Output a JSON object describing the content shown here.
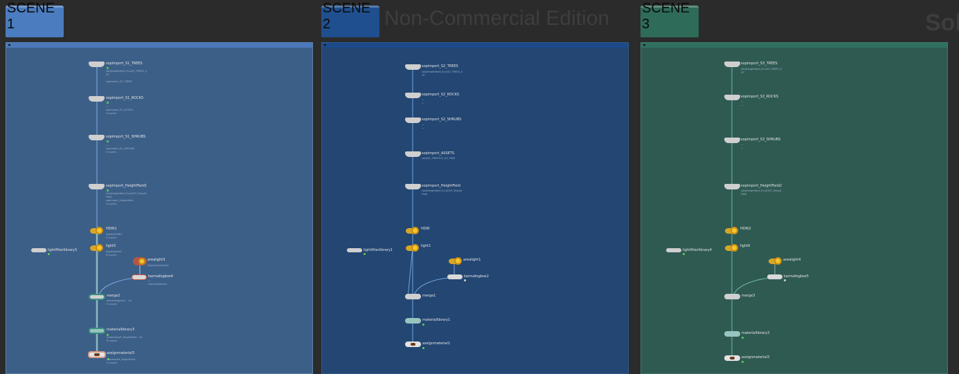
{
  "watermark": "Non-Commercial Edition",
  "watermark_right": "Sol",
  "tabs": [
    {
      "label": "SCENE 1",
      "color": "#4a7cbf"
    },
    {
      "label": "SCENE 2",
      "color": "#1f4f8f"
    },
    {
      "label": "SCENE 3",
      "color": "#2e6b58"
    }
  ],
  "panels": [
    {
      "bg": "#3c5f88",
      "bar": "#4a78b8"
    },
    {
      "bg": "#234672",
      "bar": "#1d4a88"
    },
    {
      "bg": "#2f5a52",
      "bar": "#2f7060"
    }
  ],
  "scene1": {
    "n1": {
      "label": "sopimport_S1_TREES",
      "info": "/obj/Heightfield_Ecu/S1_TREES_S\nHT\n\nsopimport_S1_TREES"
    },
    "n2": {
      "label": "sopimport_S1_ROCKS",
      "info": "—\nsopimport_S1_ROCKS\n3 Layers"
    },
    "n3": {
      "label": "sopimport_S1_SHRUBS",
      "info": "—\nsopimport_S1_SHRUBS\n3 Layers"
    },
    "n4": {
      "label": "sopimport_HeightField1",
      "info": "/obj/Heightfield_Ecu/OUT_Height\nField\nsopimport_Heightfield\n4 Layers"
    },
    "n5": {
      "label": "HDRI1",
      "info": "/lights/HDRI1\n5 Layers"
    },
    "n6": {
      "label": "light5",
      "info": "/lights/light5\n6 Layers"
    },
    "n7": {
      "label": "lightfilterlibrary3",
      "info": ""
    },
    "n8": {
      "label": "arealight3",
      "info": "/lights/arealight3"
    },
    "n9": {
      "label": "karmafogbox4",
      "info": "—\n/karmafogbox4"
    },
    "n10": {
      "label": "merge2",
      "info": "/karmafogbox4 ...16\n9 Layers"
    },
    "n11": {
      "label": "materiallibrary3",
      "info": "/materials/R_Heightfield...16\n8 Layers"
    },
    "n12": {
      "label": "assignmaterial3",
      "info": "/sopimport_HeightField\n9 Layers"
    }
  },
  "scene2": {
    "n1": {
      "label": "sopimport_S2_TREES",
      "info": "/obj/Heightfield_Ecu/S2_TREES_S\nHT"
    },
    "n2": {
      "label": "sopimport_S2_ROCKS",
      "info": "—\n—"
    },
    "n3": {
      "label": "sopimport_S2_SHRUBS",
      "info": "—\n—"
    },
    "n4": {
      "label": "sopimport_ASSETS",
      "info": "/obj/S3_TREEOUT_S3_TREE"
    },
    "n5": {
      "label": "sopimport_HeightField",
      "info": "/obj/Heightfield_Ecu/OUT_Height\nField"
    },
    "n6": {
      "label": "HDRI",
      "info": ""
    },
    "n7": {
      "label": "light1",
      "info": ""
    },
    "n8": {
      "label": "lightfilterlibrary1",
      "info": ""
    },
    "n9": {
      "label": "arealight1",
      "info": ""
    },
    "n10": {
      "label": "karmafogbox2",
      "info": ""
    },
    "n11": {
      "label": "merge1",
      "info": ""
    },
    "n12": {
      "label": "materiallibrary1",
      "info": ""
    },
    "n13": {
      "label": "assignmaterial1",
      "info": ""
    }
  },
  "scene3": {
    "n1": {
      "label": "sopimport_S3_TREES",
      "info": "/obj/Heightfield_Ecu/S3_TREES_S\nHT"
    },
    "n2": {
      "label": "sopimport_S3_ROCKS",
      "info": "—\n—"
    },
    "n3": {
      "label": "sopimport_S3_SHRUBS",
      "info": "—\n—"
    },
    "n4": {
      "label": "sopimport_HeightField2",
      "info": "/obj/Heightfield_Ecu/OUT_Height\nField"
    },
    "n5": {
      "label": "HDRI2",
      "info": ""
    },
    "n6": {
      "label": "light6",
      "info": ""
    },
    "n7": {
      "label": "lightfilterlibrary4",
      "info": ""
    },
    "n8": {
      "label": "arealight4",
      "info": ""
    },
    "n9": {
      "label": "karmafogbox5",
      "info": ""
    },
    "n10": {
      "label": "merge3",
      "info": ""
    },
    "n11": {
      "label": "materiallibrary3",
      "info": ""
    },
    "n12": {
      "label": "assignmaterial3",
      "info": ""
    }
  }
}
